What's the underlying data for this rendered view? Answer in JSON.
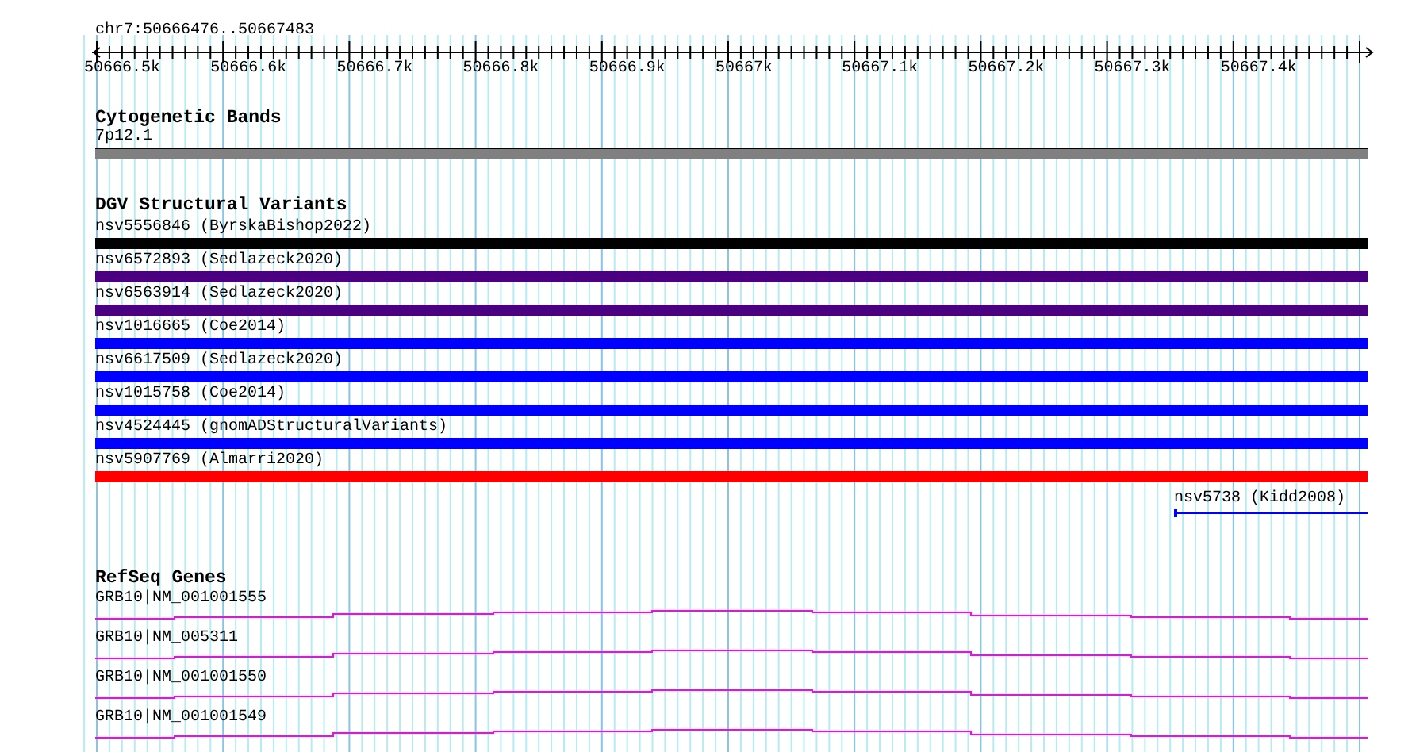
{
  "location": "chr7:50666476..50667483",
  "ruler": {
    "ticks": [
      "50666.5k",
      "50666.6k",
      "50666.7k",
      "50666.8k",
      "50666.9k",
      "50667k",
      "50667.1k",
      "50667.2k",
      "50667.3k",
      "50667.4k"
    ]
  },
  "tracks": [
    {
      "title": "Cytogenetic Bands",
      "features": [
        {
          "label": "7p12.1",
          "kind": "band",
          "color": "#808080"
        }
      ]
    },
    {
      "title": "DGV Structural Variants",
      "features": [
        {
          "label": "nsv5556846 (ByrskaBishop2022)",
          "kind": "bar",
          "color": "#000000"
        },
        {
          "label": "nsv6572893 (Sedlazeck2020)",
          "kind": "bar",
          "color": "#4b0082"
        },
        {
          "label": "nsv6563914 (Sedlazeck2020)",
          "kind": "bar",
          "color": "#4b0082"
        },
        {
          "label": "nsv1016665 (Coe2014)",
          "kind": "bar",
          "color": "#0000ff"
        },
        {
          "label": "nsv6617509 (Sedlazeck2020)",
          "kind": "bar",
          "color": "#0000ff"
        },
        {
          "label": "nsv1015758 (Coe2014)",
          "kind": "bar",
          "color": "#0000ff"
        },
        {
          "label": "nsv4524445 (gnomADStructuralVariants)",
          "kind": "bar",
          "color": "#0000ff"
        },
        {
          "label": "nsv5907769 (Almarri2020)",
          "kind": "bar",
          "color": "#ff0000"
        },
        {
          "label": "nsv5738 (Kidd2008)",
          "kind": "partial",
          "color": "#0000ff"
        }
      ]
    },
    {
      "title": "RefSeq Genes",
      "features": [
        {
          "label": "GRB10|NM_001001555",
          "kind": "gene",
          "color": "#ff00ff"
        },
        {
          "label": "GRB10|NM_005311",
          "kind": "gene",
          "color": "#ff00ff"
        },
        {
          "label": "GRB10|NM_001001550",
          "kind": "gene",
          "color": "#ff00ff"
        },
        {
          "label": "GRB10|NM_001001549",
          "kind": "gene",
          "color": "#ff00ff"
        }
      ]
    }
  ]
}
